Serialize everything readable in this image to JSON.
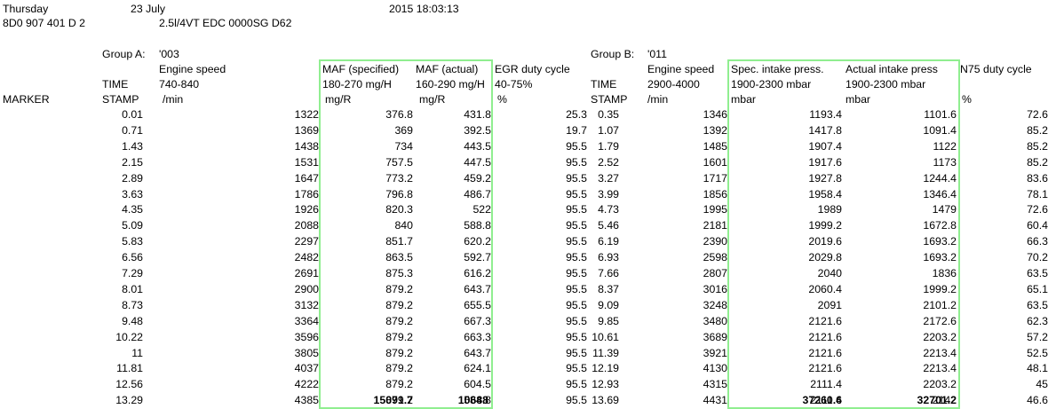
{
  "header": {
    "day": "Thursday",
    "date": "23 July",
    "datetime": "2015 18:03:13",
    "part_number": "8D0 907 401 D 2",
    "ecu_description": "2.5l/4VT EDC 0000SG D62"
  },
  "group_a": {
    "label": "Group A:",
    "id": "'003",
    "col_time": [
      "TIME",
      "STAMP"
    ],
    "col_speed": [
      "Engine speed",
      "740-840",
      "/min"
    ],
    "col_maf_spec": [
      "MAF (specified)",
      "180-270 mg/H",
      " mg/R"
    ],
    "col_maf_act": [
      "MAF (actual)",
      "160-290 mg/H",
      "mg/R"
    ],
    "col_egr": [
      "EGR duty cycle",
      "40-75%",
      " %"
    ]
  },
  "group_b": {
    "label": "Group B:",
    "id": "'011",
    "col_time": [
      "TIME",
      "STAMP"
    ],
    "col_speed": [
      "Engine speed",
      "2900-4000",
      " /min"
    ],
    "col_spec_press": [
      "Spec. intake press.",
      "1900-2300 mbar",
      " mbar"
    ],
    "col_act_press": [
      "Actual intake press",
      "1900-2300 mbar",
      " mbar"
    ],
    "col_n75": [
      "N75 duty cycle",
      "",
      " %"
    ]
  },
  "marker_label": "MARKER",
  "rows": [
    [
      "0.01",
      "1322",
      "376.8",
      "431.8",
      "25.3",
      "0.35",
      "1346",
      "1193.4",
      "1101.6",
      "72.6"
    ],
    [
      "0.71",
      "1369",
      "369",
      "392.5",
      "19.7",
      "1.07",
      "1392",
      "1417.8",
      "1091.4",
      "85.2"
    ],
    [
      "1.43",
      "1438",
      "734",
      "443.5",
      "95.5",
      "1.79",
      "1485",
      "1907.4",
      "1122",
      "85.2"
    ],
    [
      "2.15",
      "1531",
      "757.5",
      "447.5",
      "95.5",
      "2.52",
      "1601",
      "1917.6",
      "1173",
      "85.2"
    ],
    [
      "2.89",
      "1647",
      "773.2",
      "459.2",
      "95.5",
      "3.27",
      "1717",
      "1927.8",
      "1244.4",
      "83.6"
    ],
    [
      "3.63",
      "1786",
      "796.8",
      "486.7",
      "95.5",
      "3.99",
      "1856",
      "1958.4",
      "1346.4",
      "78.1"
    ],
    [
      "4.35",
      "1926",
      "820.3",
      "522",
      "95.5",
      "4.73",
      "1995",
      "1989",
      "1479",
      "72.6"
    ],
    [
      "5.09",
      "2088",
      "840",
      "588.8",
      "95.5",
      "5.46",
      "2181",
      "1999.2",
      "1672.8",
      "60.4"
    ],
    [
      "5.83",
      "2297",
      "851.7",
      "620.2",
      "95.5",
      "6.19",
      "2390",
      "2019.6",
      "1693.2",
      "66.3"
    ],
    [
      "6.56",
      "2482",
      "863.5",
      "592.7",
      "95.5",
      "6.93",
      "2598",
      "2029.8",
      "1693.2",
      "70.2"
    ],
    [
      "7.29",
      "2691",
      "875.3",
      "616.2",
      "95.5",
      "7.66",
      "2807",
      "2040",
      "1836",
      "63.5"
    ],
    [
      "8.01",
      "2900",
      "879.2",
      "643.7",
      "95.5",
      "8.37",
      "3016",
      "2060.4",
      "1999.2",
      "65.1"
    ],
    [
      "8.73",
      "3132",
      "879.2",
      "655.5",
      "95.5",
      "9.09",
      "3248",
      "2091",
      "2101.2",
      "63.5"
    ],
    [
      "9.48",
      "3364",
      "879.2",
      "667.3",
      "95.5",
      "9.85",
      "3480",
      "2121.6",
      "2172.6",
      "62.3"
    ],
    [
      "10.22",
      "3596",
      "879.2",
      "663.3",
      "95.5",
      "10.61",
      "3689",
      "2121.6",
      "2203.2",
      "57.2"
    ],
    [
      "11",
      "3805",
      "879.2",
      "643.7",
      "95.5",
      "11.39",
      "3921",
      "2121.6",
      "2213.4",
      "52.5"
    ],
    [
      "11.81",
      "4037",
      "879.2",
      "624.1",
      "95.5",
      "12.19",
      "4130",
      "2121.6",
      "2213.4",
      "48.1"
    ],
    [
      "12.56",
      "4222",
      "879.2",
      "604.5",
      "95.5",
      "12.93",
      "4315",
      "2111.4",
      "2203.2",
      "45"
    ],
    [
      "13.29",
      "4385",
      "879.2",
      "584.8",
      "95.5",
      "13.69",
      "4431",
      "2111.4",
      "2142",
      "46.6"
    ]
  ],
  "totals": {
    "maf_spec": "15091.7",
    "maf_act": "10688",
    "spec_press": "37260.6",
    "act_press": "32701.2"
  }
}
